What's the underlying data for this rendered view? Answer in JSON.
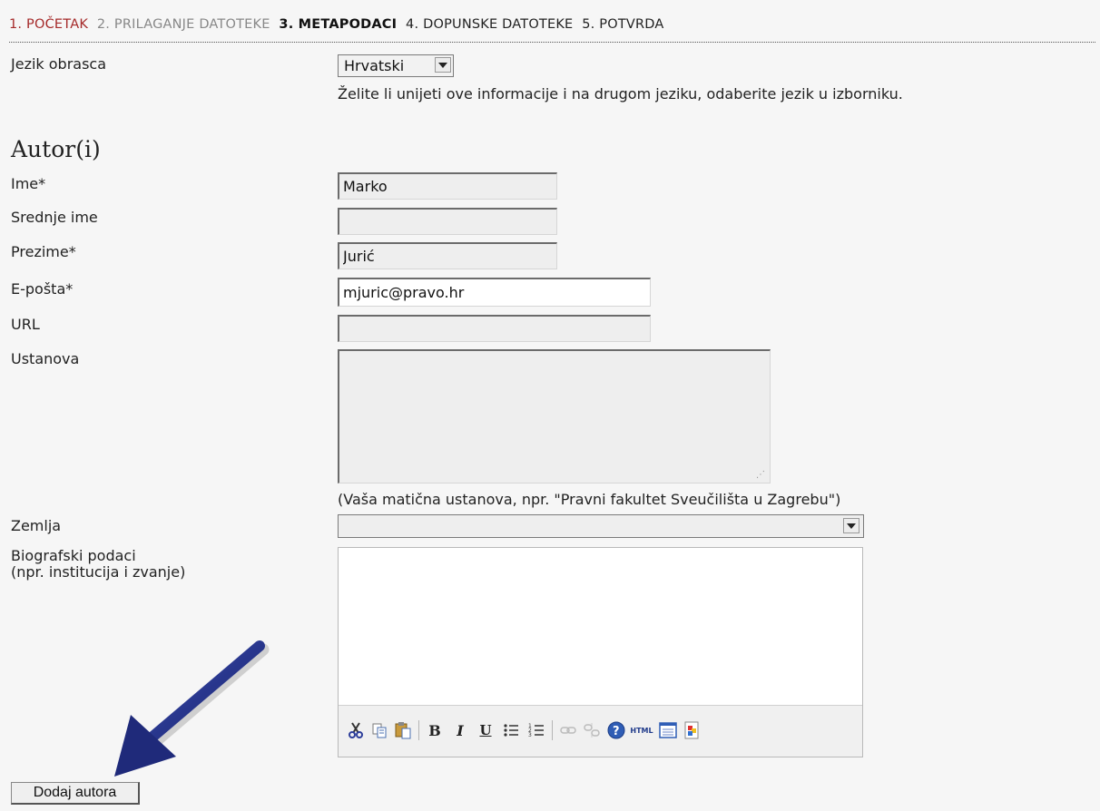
{
  "steps": [
    {
      "label": "1. POČETAK",
      "state": "done"
    },
    {
      "label": "2. PRILAGANJE DATOTEKE",
      "state": "inactive"
    },
    {
      "label": "3. METAPODACI",
      "state": "current"
    },
    {
      "label": "4. DOPUNSKE DATOTEKE",
      "state": "upcoming"
    },
    {
      "label": "5. POTVRDA",
      "state": "upcoming"
    }
  ],
  "form_language": {
    "label": "Jezik obrasca",
    "selected": "Hrvatski",
    "hint": "Želite li unijeti ove informacije i na drugom jeziku, odaberite jezik u izborniku."
  },
  "authors_heading": "Autor(i)",
  "fields": {
    "first_name": {
      "label": "Ime*",
      "value": "Marko"
    },
    "middle_name": {
      "label": "Srednje ime",
      "value": ""
    },
    "last_name": {
      "label": "Prezime*",
      "value": "Jurić"
    },
    "email": {
      "label": "E-pošta*",
      "value": "mjuric@pravo.hr"
    },
    "url": {
      "label": "URL",
      "value": ""
    },
    "affiliation": {
      "label": "Ustanova",
      "value": "",
      "hint": "(Vaša matična ustanova, npr. \"Pravni fakultet Sveučilišta u Zagrebu\")"
    },
    "country": {
      "label": "Zemlja",
      "selected": ""
    },
    "bio": {
      "label_line1": "Biografski podaci",
      "label_line2": "(npr. institucija i zvanje)",
      "value": ""
    }
  },
  "editor_toolbar": {
    "buttons": [
      "cut-icon",
      "copy-icon",
      "paste-icon",
      "bold-icon",
      "italic-icon",
      "underline-icon",
      "bullet-list-icon",
      "numbered-list-icon",
      "link-icon",
      "unlink-icon",
      "help-icon",
      "html-icon",
      "fullscreen-icon",
      "image-icon"
    ],
    "bold": "B",
    "italic": "I",
    "underline": "U",
    "html": "HTML"
  },
  "add_author_button": "Dodaj autora",
  "colors": {
    "step_done": "#a52a2a",
    "arrow": "#1f2a7a",
    "background": "#f6f6f6"
  }
}
